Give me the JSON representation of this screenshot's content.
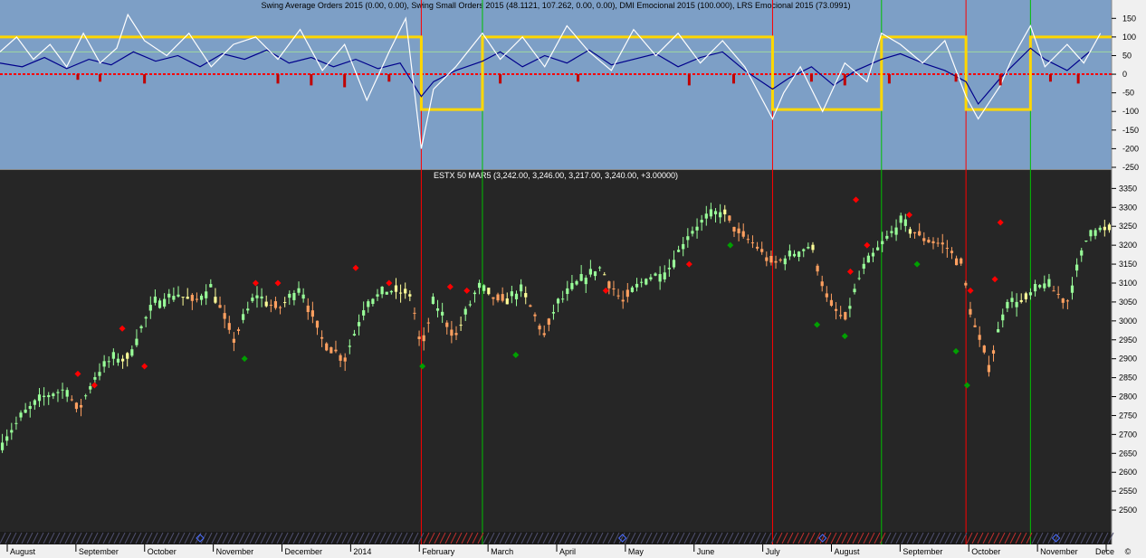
{
  "chart_data": [
    {
      "type": "line",
      "title": "Swing Average Orders 2015 (0.00, 0.00), Swing Small Orders 2015 (48.1121, 107.262, 0.00, 0.00), DMI Emocional 2015 (100.000), LRS Emocional 2015 (73.0991)",
      "ylim": [
        -250,
        175
      ],
      "yticks": [
        150,
        100,
        50,
        0,
        -50,
        -100,
        -150,
        -200,
        -250
      ],
      "grid": false,
      "colors": {
        "background": "#7d9fc6",
        "axis_panel": "#f0f0f0",
        "dmi": "#ffd700",
        "lrs": "#00008b",
        "swing_small": "#ffffff",
        "swing_average": "#c00000",
        "signal_line": "#9ed8a0",
        "zero_line": "#ff0000"
      },
      "series": [
        {
          "name": "DMI Emocional 2015",
          "style": "step",
          "x_fraction": [
            0,
            0.379,
            0.434,
            0.695,
            0.793,
            0.869,
            0.927,
            1
          ],
          "values": [
            100,
            -95,
            100,
            -95,
            100,
            -95,
            100,
            100
          ]
        },
        {
          "name": "LRS Emocional 2015",
          "x_fraction": [
            0,
            0.02,
            0.04,
            0.06,
            0.08,
            0.1,
            0.12,
            0.14,
            0.16,
            0.18,
            0.2,
            0.22,
            0.24,
            0.26,
            0.28,
            0.3,
            0.32,
            0.34,
            0.36,
            0.379,
            0.39,
            0.41,
            0.434,
            0.45,
            0.47,
            0.49,
            0.51,
            0.53,
            0.55,
            0.57,
            0.59,
            0.61,
            0.63,
            0.65,
            0.67,
            0.695,
            0.71,
            0.73,
            0.75,
            0.77,
            0.793,
            0.81,
            0.83,
            0.85,
            0.869,
            0.88,
            0.9,
            0.91,
            0.927,
            0.94,
            0.96,
            0.98
          ],
          "values": [
            30,
            20,
            45,
            15,
            40,
            25,
            60,
            35,
            50,
            20,
            55,
            40,
            65,
            30,
            45,
            20,
            40,
            15,
            30,
            -60,
            -20,
            10,
            35,
            60,
            20,
            50,
            30,
            65,
            25,
            40,
            55,
            20,
            45,
            60,
            10,
            -40,
            -10,
            20,
            -30,
            10,
            40,
            55,
            30,
            10,
            -20,
            -80,
            -10,
            20,
            70,
            40,
            10,
            60
          ]
        },
        {
          "name": "Swing Small Orders 2015",
          "x_fraction": [
            0,
            0.015,
            0.03,
            0.045,
            0.06,
            0.075,
            0.09,
            0.105,
            0.115,
            0.13,
            0.15,
            0.17,
            0.19,
            0.21,
            0.23,
            0.25,
            0.27,
            0.29,
            0.31,
            0.33,
            0.35,
            0.365,
            0.379,
            0.39,
            0.41,
            0.434,
            0.45,
            0.47,
            0.49,
            0.51,
            0.53,
            0.55,
            0.57,
            0.59,
            0.61,
            0.63,
            0.65,
            0.67,
            0.695,
            0.705,
            0.72,
            0.74,
            0.76,
            0.78,
            0.793,
            0.81,
            0.83,
            0.85,
            0.869,
            0.88,
            0.9,
            0.91,
            0.927,
            0.94,
            0.96,
            0.975,
            0.99
          ],
          "values": [
            60,
            100,
            40,
            80,
            20,
            110,
            30,
            70,
            160,
            90,
            50,
            110,
            20,
            80,
            100,
            40,
            120,
            10,
            80,
            -70,
            60,
            150,
            -200,
            -40,
            20,
            110,
            40,
            100,
            20,
            130,
            60,
            10,
            120,
            50,
            110,
            30,
            90,
            20,
            -120,
            -50,
            20,
            -100,
            30,
            -20,
            110,
            80,
            30,
            90,
            -60,
            -120,
            -30,
            40,
            130,
            20,
            80,
            30,
            110
          ]
        },
        {
          "name": "Swing Average Orders 2015",
          "style": "histogram",
          "x_fraction": [
            0.07,
            0.09,
            0.13,
            0.25,
            0.28,
            0.31,
            0.35,
            0.45,
            0.52,
            0.62,
            0.66,
            0.73,
            0.76,
            0.8,
            0.86,
            0.9,
            0.945,
            0.97
          ],
          "values": [
            -15,
            -20,
            -25,
            -25,
            -30,
            -35,
            -20,
            -25,
            -20,
            -30,
            -25,
            -20,
            -30,
            -25,
            -20,
            -30,
            -20,
            -25
          ]
        }
      ]
    },
    {
      "type": "candlestick",
      "title": "ESTX 50 MAR5 (3,242.00, 3,246.00, 3,217.00, 3,240.00, +3.00000)",
      "ylim": [
        2450,
        3370
      ],
      "yticks": [
        3350,
        3300,
        3250,
        3200,
        3150,
        3100,
        3050,
        3000,
        2950,
        2900,
        2850,
        2800,
        2750,
        2700,
        2650,
        2600,
        2550,
        2500
      ],
      "xticks": [
        "August",
        "September",
        "October",
        "November",
        "December",
        "2014",
        "February",
        "March",
        "April",
        "May",
        "June",
        "July",
        "August",
        "September",
        "October",
        "November",
        "Dece"
      ],
      "grid": false,
      "colors": {
        "background": "#262626",
        "axis_panel": "#f0f0f0",
        "bar_neutral": "#ffff99",
        "bar_up": "#99ff99",
        "bar_down": "#ffa060",
        "marker_high": "#ff0000",
        "marker_low": "#00a000",
        "sell_line": "#ff0000",
        "buy_line": "#00c000"
      },
      "close_path": {
        "x_fraction": [
          0,
          0.02,
          0.04,
          0.06,
          0.07,
          0.085,
          0.1,
          0.115,
          0.13,
          0.14,
          0.16,
          0.175,
          0.19,
          0.21,
          0.23,
          0.25,
          0.27,
          0.29,
          0.31,
          0.33,
          0.35,
          0.37,
          0.379,
          0.39,
          0.41,
          0.43,
          0.45,
          0.47,
          0.49,
          0.5,
          0.52,
          0.54,
          0.56,
          0.58,
          0.6,
          0.62,
          0.635,
          0.65,
          0.665,
          0.68,
          0.695,
          0.71,
          0.73,
          0.745,
          0.76,
          0.775,
          0.793,
          0.81,
          0.83,
          0.85,
          0.865,
          0.875,
          0.89,
          0.905,
          0.92,
          0.94,
          0.96,
          0.98
        ],
        "values": [
          2670,
          2750,
          2800,
          2820,
          2760,
          2850,
          2900,
          2900,
          3000,
          3050,
          3070,
          3050,
          3090,
          2950,
          3070,
          3030,
          3090,
          2950,
          2900,
          3050,
          3080,
          3070,
          2920,
          3050,
          2960,
          3090,
          3050,
          3080,
          2960,
          3040,
          3100,
          3140,
          3050,
          3110,
          3130,
          3230,
          3270,
          3290,
          3230,
          3200,
          3150,
          3170,
          3200,
          3050,
          3000,
          3130,
          3200,
          3260,
          3220,
          3200,
          3150,
          3000,
          2880,
          3050,
          3050,
          3100,
          3050,
          3240
        ]
      },
      "high_markers": {
        "x_fraction": [
          0.07,
          0.085,
          0.11,
          0.13,
          0.23,
          0.25,
          0.32,
          0.35,
          0.405,
          0.42,
          0.545,
          0.62,
          0.77,
          0.765,
          0.78,
          0.818,
          0.873,
          0.895,
          0.9
        ],
        "values": [
          2860,
          2830,
          2980,
          2880,
          3100,
          3100,
          3140,
          3100,
          3090,
          3080,
          3080,
          3150,
          3320,
          3130,
          3200,
          3280,
          3080,
          3110,
          3260
        ]
      },
      "low_markers": {
        "x_fraction": [
          0.22,
          0.38,
          0.464,
          0.657,
          0.735,
          0.76,
          0.825,
          0.86,
          0.87
        ],
        "values": [
          2900,
          2880,
          2910,
          3200,
          2990,
          2960,
          3150,
          2920,
          2830
        ]
      },
      "signal_lines": [
        {
          "kind": "sell",
          "x_fraction": 0.379
        },
        {
          "kind": "buy",
          "x_fraction": 0.434
        },
        {
          "kind": "sell",
          "x_fraction": 0.695
        },
        {
          "kind": "buy",
          "x_fraction": 0.793
        },
        {
          "kind": "sell",
          "x_fraction": 0.869
        },
        {
          "kind": "buy",
          "x_fraction": 0.927
        }
      ]
    }
  ],
  "copyright_symbol": "©"
}
